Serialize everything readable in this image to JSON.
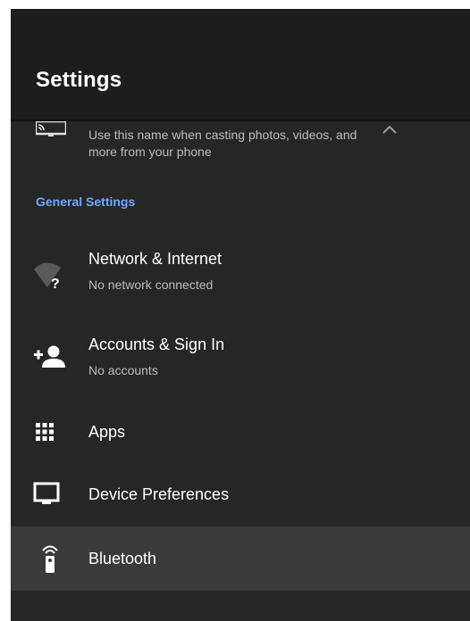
{
  "header": {
    "title": "Settings"
  },
  "device_name": {
    "description": "Use this name when casting photos, videos, and more from your phone",
    "icon": "cast-icon",
    "expand_icon": "chevron-up-icon"
  },
  "section": {
    "label": "General Settings"
  },
  "items": [
    {
      "title": "Network & Internet",
      "subtitle": "No network connected",
      "icon": "wifi-unknown-icon"
    },
    {
      "title": "Accounts & Sign In",
      "subtitle": "No accounts",
      "icon": "person-add-icon"
    },
    {
      "title": "Apps",
      "icon": "apps-grid-icon"
    },
    {
      "title": "Device Preferences",
      "icon": "tv-icon"
    },
    {
      "title": "Bluetooth",
      "icon": "remote-control-icon",
      "focused": true
    }
  ],
  "colors": {
    "background": "#262626",
    "header": "#1d1d1d",
    "accent": "#6fa8ff",
    "focus": "#3a3a3a"
  }
}
